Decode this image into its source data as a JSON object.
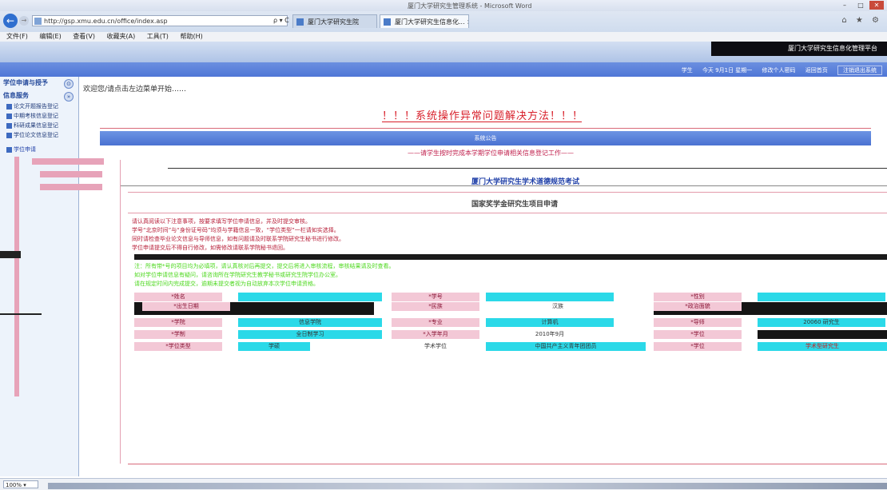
{
  "window": {
    "title": "厦门大学研究生管理系统 - Microsoft Word",
    "controls": [
      "–",
      "□",
      "✕"
    ]
  },
  "browser": {
    "url": "http://gsp.xmu.edu.cn/office/index.asp",
    "url_actions": "ρ ▾ C",
    "tabs": [
      {
        "label": "厦门大学研究生院"
      },
      {
        "label": "厦门大学研究生信息化... ×"
      }
    ],
    "right_icons": "⌂ ★ ⚙"
  },
  "menubar": [
    "文件(F)",
    "编辑(E)",
    "查看(V)",
    "收藏夹(A)",
    "工具(T)",
    "帮助(H)"
  ],
  "banner": {
    "right_text": "厦门大学研究生信息化管理平台"
  },
  "topnav": {
    "user": "学生",
    "links": [
      "今天 9月1日 星期一",
      "修改个人密码",
      "返回首页"
    ],
    "logout": "注销退出系统"
  },
  "sidebar": {
    "head1": "学位申请与授予",
    "head2": "信息服务",
    "items": [
      {
        "label": "论文开题报告登记"
      },
      {
        "label": "中期考核信息登记"
      },
      {
        "label": "科研成果信息登记"
      },
      {
        "label": "学位论文信息登记"
      },
      {
        "label": "学位申请"
      }
    ],
    "collapse_glyph": "⊙",
    "expand_glyph": "»"
  },
  "main": {
    "welcome": "欢迎您/请点击左边菜单开始……",
    "system_title": "！！！系统操作异常问题解决方法！！！",
    "notice_bar": "系统公告",
    "notice_msg": "——请学生按时完成本学期学位申请相关信息登记工作——",
    "link1": "厦门大学研究生学术道德规范考试",
    "link2": "国家奖学金研究生项目申请",
    "notes_red": [
      "请认真阅读以下注意事项，按要求填写学位申请信息，并及时提交审核。",
      "学号“北京时间”与“身份证号码”均须与学籍信息一致，“学位类型”一栏请如实选择。",
      "同时请检查毕业论文信息与导师信息，如有问题请及时联系学院研究生秘书进行修改。",
      "学位申请提交后不得自行修改，如需修改请联系学院秘书退回。"
    ],
    "notes_green": [
      "注：所有带*号的项目均为必填项，请认真核对后再提交，提交后将进入审核流程，审核结果请及时查看。",
      "如对学位申请信息有疑问，请咨询所在学院研究生教学秘书或研究生院学位办公室。",
      "请在规定时间内完成提交，逾期未提交者视为自动放弃本次学位申请资格。"
    ],
    "form": {
      "row1": [
        "*姓名",
        "*学号",
        "*性别"
      ],
      "row2": [
        "*出生日期",
        "*民族",
        "汉族",
        "*政治面貌"
      ],
      "row3": [
        "*学院",
        "信息学院",
        "*专业",
        "计算机",
        "*导师",
        "20060 研究生"
      ],
      "row4": [
        "*学制",
        "全日制学习",
        "*入学年月",
        "2010年9月",
        "*学位"
      ],
      "row5": [
        "*学位类型",
        "学硕",
        "学术学位",
        "中国共产主义青年团团员",
        "*学位",
        "学术型研究生"
      ]
    }
  },
  "status": {
    "zoom": "100% ▾"
  }
}
